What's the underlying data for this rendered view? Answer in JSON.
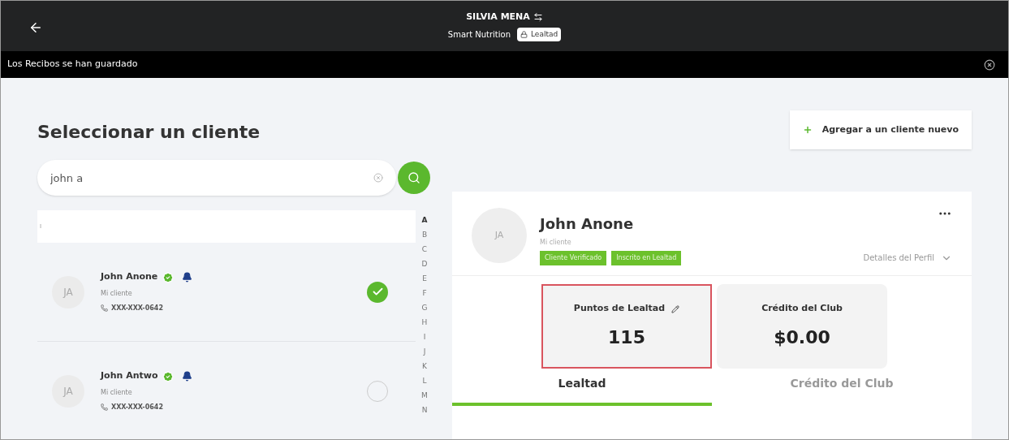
{
  "header": {
    "title": "SILVIA MENA",
    "subtitle": "Smart Nutrition",
    "chip": "Lealtad"
  },
  "notification": {
    "message": "Los Recibos se han guardado"
  },
  "page": {
    "title": "Seleccionar un cliente",
    "add_button": "Agregar a un cliente nuevo"
  },
  "search": {
    "value": "john a"
  },
  "list_header": "I",
  "clients": [
    {
      "initials": "JA",
      "name": "John Anone",
      "verified": true,
      "loyalty": true,
      "type": "Mi cliente",
      "phone": "XXX-XXX-0642",
      "selected": true
    },
    {
      "initials": "JA",
      "name": "John Antwo",
      "verified": true,
      "loyalty": true,
      "type": "Mi cliente",
      "phone": "XXX-XXX-0642",
      "selected": false
    }
  ],
  "alphabet": [
    "A",
    "B",
    "C",
    "D",
    "E",
    "F",
    "G",
    "H",
    "I",
    "J",
    "K",
    "L",
    "M",
    "N"
  ],
  "profile": {
    "initials": "JA",
    "name": "John Anone",
    "type": "Mi cliente",
    "tags": [
      "Cliente Verificado",
      "Inscrito en Lealtad"
    ],
    "details": "Detalles del Perfil",
    "stats": [
      {
        "label": "Puntos de Lealtad",
        "value": "115",
        "editable": true,
        "highlighted": true
      },
      {
        "label": "Crédito del Club",
        "value": "$0.00",
        "editable": false,
        "highlighted": false
      }
    ],
    "tabs": [
      {
        "label": "Lealtad",
        "selected": true
      },
      {
        "label": "Crédito del Club",
        "selected": false
      }
    ]
  }
}
